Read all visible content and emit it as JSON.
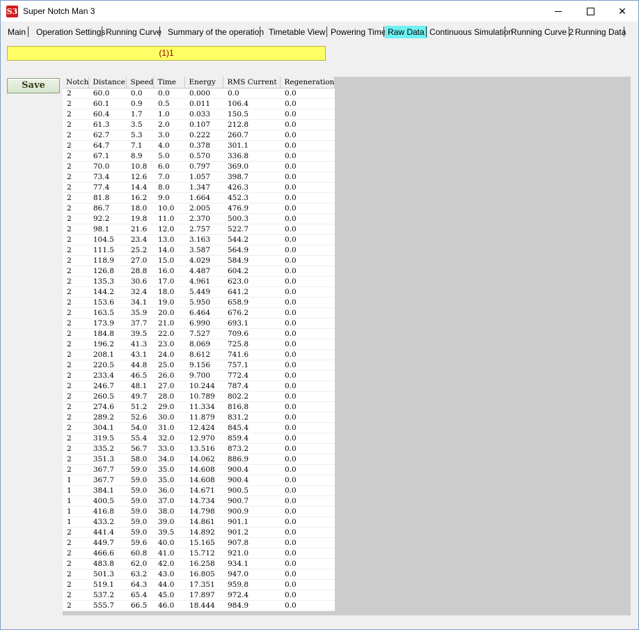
{
  "window": {
    "title": "Super Notch Man 3",
    "icon": "S3"
  },
  "tabs": [
    "Main",
    "Operation Settings",
    "Running Curve",
    "Summary of the operation",
    "Timetable View",
    "Powering Time",
    "Raw Data",
    "Continuous Simulation",
    "Running Curve 2",
    "Running Data"
  ],
  "active_tab": "Raw Data",
  "status_bar": {
    "text": "(1)1"
  },
  "save_label": "Save",
  "colors": {
    "active_tab": "#6ff2f2",
    "status_bar": "#ffff66",
    "app_icon": "#d41b1b"
  },
  "table": {
    "columns": [
      "Notch",
      "Distance",
      "Speed",
      "Time",
      "Energy",
      "RMS Current",
      "Regeneration"
    ],
    "rows": [
      [
        "2",
        "60.0",
        "0.0",
        "0.0",
        "0.000",
        "0.0",
        "0.0"
      ],
      [
        "2",
        "60.1",
        "0.9",
        "0.5",
        "0.011",
        "106.4",
        "0.0"
      ],
      [
        "2",
        "60.4",
        "1.7",
        "1.0",
        "0.033",
        "150.5",
        "0.0"
      ],
      [
        "2",
        "61.3",
        "3.5",
        "2.0",
        "0.107",
        "212.8",
        "0.0"
      ],
      [
        "2",
        "62.7",
        "5.3",
        "3.0",
        "0.222",
        "260.7",
        "0.0"
      ],
      [
        "2",
        "64.7",
        "7.1",
        "4.0",
        "0.378",
        "301.1",
        "0.0"
      ],
      [
        "2",
        "67.1",
        "8.9",
        "5.0",
        "0.570",
        "336.8",
        "0.0"
      ],
      [
        "2",
        "70.0",
        "10.8",
        "6.0",
        "0.797",
        "369.0",
        "0.0"
      ],
      [
        "2",
        "73.4",
        "12.6",
        "7.0",
        "1.057",
        "398.7",
        "0.0"
      ],
      [
        "2",
        "77.4",
        "14.4",
        "8.0",
        "1.347",
        "426.3",
        "0.0"
      ],
      [
        "2",
        "81.8",
        "16.2",
        "9.0",
        "1.664",
        "452.3",
        "0.0"
      ],
      [
        "2",
        "86.7",
        "18.0",
        "10.0",
        "2.005",
        "476.9",
        "0.0"
      ],
      [
        "2",
        "92.2",
        "19.8",
        "11.0",
        "2.370",
        "500.3",
        "0.0"
      ],
      [
        "2",
        "98.1",
        "21.6",
        "12.0",
        "2.757",
        "522.7",
        "0.0"
      ],
      [
        "2",
        "104.5",
        "23.4",
        "13.0",
        "3.163",
        "544.2",
        "0.0"
      ],
      [
        "2",
        "111.5",
        "25.2",
        "14.0",
        "3.587",
        "564.9",
        "0.0"
      ],
      [
        "2",
        "118.9",
        "27.0",
        "15.0",
        "4.029",
        "584.9",
        "0.0"
      ],
      [
        "2",
        "126.8",
        "28.8",
        "16.0",
        "4.487",
        "604.2",
        "0.0"
      ],
      [
        "2",
        "135.3",
        "30.6",
        "17.0",
        "4.961",
        "623.0",
        "0.0"
      ],
      [
        "2",
        "144.2",
        "32.4",
        "18.0",
        "5.449",
        "641.2",
        "0.0"
      ],
      [
        "2",
        "153.6",
        "34.1",
        "19.0",
        "5.950",
        "658.9",
        "0.0"
      ],
      [
        "2",
        "163.5",
        "35.9",
        "20.0",
        "6.464",
        "676.2",
        "0.0"
      ],
      [
        "2",
        "173.9",
        "37.7",
        "21.0",
        "6.990",
        "693.1",
        "0.0"
      ],
      [
        "2",
        "184.8",
        "39.5",
        "22.0",
        "7.527",
        "709.6",
        "0.0"
      ],
      [
        "2",
        "196.2",
        "41.3",
        "23.0",
        "8.069",
        "725.8",
        "0.0"
      ],
      [
        "2",
        "208.1",
        "43.1",
        "24.0",
        "8.612",
        "741.6",
        "0.0"
      ],
      [
        "2",
        "220.5",
        "44.8",
        "25.0",
        "9.156",
        "757.1",
        "0.0"
      ],
      [
        "2",
        "233.4",
        "46.5",
        "26.0",
        "9.700",
        "772.4",
        "0.0"
      ],
      [
        "2",
        "246.7",
        "48.1",
        "27.0",
        "10.244",
        "787.4",
        "0.0"
      ],
      [
        "2",
        "260.5",
        "49.7",
        "28.0",
        "10.789",
        "802.2",
        "0.0"
      ],
      [
        "2",
        "274.6",
        "51.2",
        "29.0",
        "11.334",
        "816.8",
        "0.0"
      ],
      [
        "2",
        "289.2",
        "52.6",
        "30.0",
        "11.879",
        "831.2",
        "0.0"
      ],
      [
        "2",
        "304.1",
        "54.0",
        "31.0",
        "12.424",
        "845.4",
        "0.0"
      ],
      [
        "2",
        "319.5",
        "55.4",
        "32.0",
        "12.970",
        "859.4",
        "0.0"
      ],
      [
        "2",
        "335.2",
        "56.7",
        "33.0",
        "13.516",
        "873.2",
        "0.0"
      ],
      [
        "2",
        "351.3",
        "58.0",
        "34.0",
        "14.062",
        "886.9",
        "0.0"
      ],
      [
        "2",
        "367.7",
        "59.0",
        "35.0",
        "14.608",
        "900.4",
        "0.0"
      ],
      [
        "1",
        "367.7",
        "59.0",
        "35.0",
        "14.608",
        "900.4",
        "0.0"
      ],
      [
        "1",
        "384.1",
        "59.0",
        "36.0",
        "14.671",
        "900.5",
        "0.0"
      ],
      [
        "1",
        "400.5",
        "59.0",
        "37.0",
        "14.734",
        "900.7",
        "0.0"
      ],
      [
        "1",
        "416.8",
        "59.0",
        "38.0",
        "14.798",
        "900.9",
        "0.0"
      ],
      [
        "1",
        "433.2",
        "59.0",
        "39.0",
        "14.861",
        "901.1",
        "0.0"
      ],
      [
        "2",
        "441.4",
        "59.0",
        "39.5",
        "14.892",
        "901.2",
        "0.0"
      ],
      [
        "2",
        "449.7",
        "59.6",
        "40.0",
        "15.165",
        "907.8",
        "0.0"
      ],
      [
        "2",
        "466.6",
        "60.8",
        "41.0",
        "15.712",
        "921.0",
        "0.0"
      ],
      [
        "2",
        "483.8",
        "62.0",
        "42.0",
        "16.258",
        "934.1",
        "0.0"
      ],
      [
        "2",
        "501.3",
        "63.2",
        "43.0",
        "16.805",
        "947.0",
        "0.0"
      ],
      [
        "2",
        "519.1",
        "64.3",
        "44.0",
        "17.351",
        "959.8",
        "0.0"
      ],
      [
        "2",
        "537.2",
        "65.4",
        "45.0",
        "17.897",
        "972.4",
        "0.0"
      ],
      [
        "2",
        "555.7",
        "66.5",
        "46.0",
        "18.444",
        "984.9",
        "0.0"
      ]
    ]
  }
}
